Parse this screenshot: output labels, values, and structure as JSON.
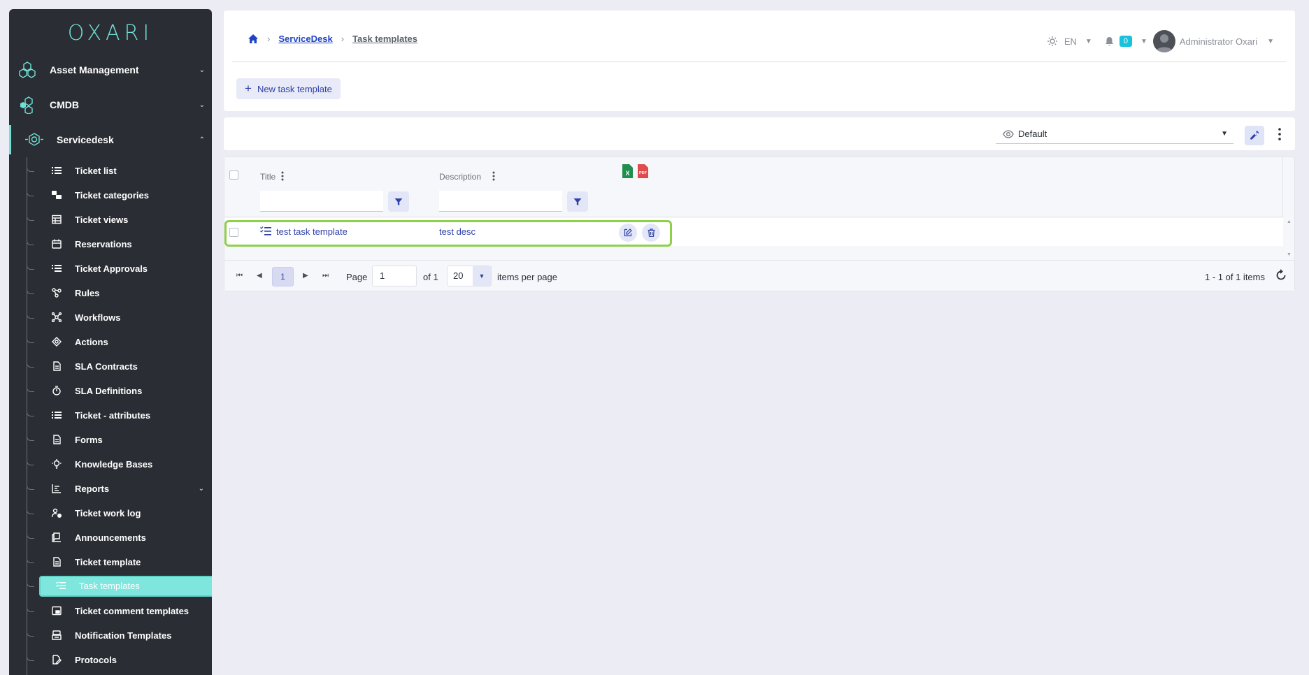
{
  "brand": {
    "logo_text": "OXARI"
  },
  "sidebar": {
    "top_items": [
      {
        "label": "Asset Management"
      },
      {
        "label": "CMDB"
      },
      {
        "label": "Servicedesk"
      }
    ],
    "sub_items": [
      {
        "label": "Ticket list"
      },
      {
        "label": "Ticket categories"
      },
      {
        "label": "Ticket views"
      },
      {
        "label": "Reservations"
      },
      {
        "label": "Ticket Approvals"
      },
      {
        "label": "Rules"
      },
      {
        "label": "Workflows"
      },
      {
        "label": "Actions"
      },
      {
        "label": "SLA Contracts"
      },
      {
        "label": "SLA Definitions"
      },
      {
        "label": "Ticket - attributes"
      },
      {
        "label": "Forms"
      },
      {
        "label": "Knowledge Bases"
      },
      {
        "label": "Reports"
      },
      {
        "label": "Ticket work log"
      },
      {
        "label": "Announcements"
      },
      {
        "label": "Ticket template"
      },
      {
        "label": "Task templates"
      },
      {
        "label": "Ticket comment templates"
      },
      {
        "label": "Notification Templates"
      },
      {
        "label": "Protocols"
      }
    ],
    "active_item": "Task templates"
  },
  "header": {
    "breadcrumb": {
      "section": "ServiceDesk",
      "current": "Task templates"
    },
    "language": "EN",
    "notification_count": "0",
    "user_name": "Administrator Oxari",
    "new_button_label": "New task template"
  },
  "toolbar": {
    "view_name": "Default"
  },
  "grid": {
    "columns": [
      {
        "title": "Title"
      },
      {
        "title": "Description"
      }
    ],
    "rows": [
      {
        "title": "test task template",
        "description": "test desc"
      }
    ],
    "export_icons": [
      "excel-icon",
      "pdf-icon"
    ]
  },
  "pager": {
    "current_page_button": "1",
    "page_label": "Page",
    "page_value": "1",
    "of_label": "of 1",
    "page_size": "20",
    "items_per_page_label": "items per page",
    "summary": "1 - 1 of 1 items"
  },
  "colors": {
    "sidebar_bg": "#2a2d33",
    "accent": "#6fe0d5",
    "link": "#2144c2",
    "highlight_border": "#8fd04a",
    "badge": "#19c2dc"
  }
}
